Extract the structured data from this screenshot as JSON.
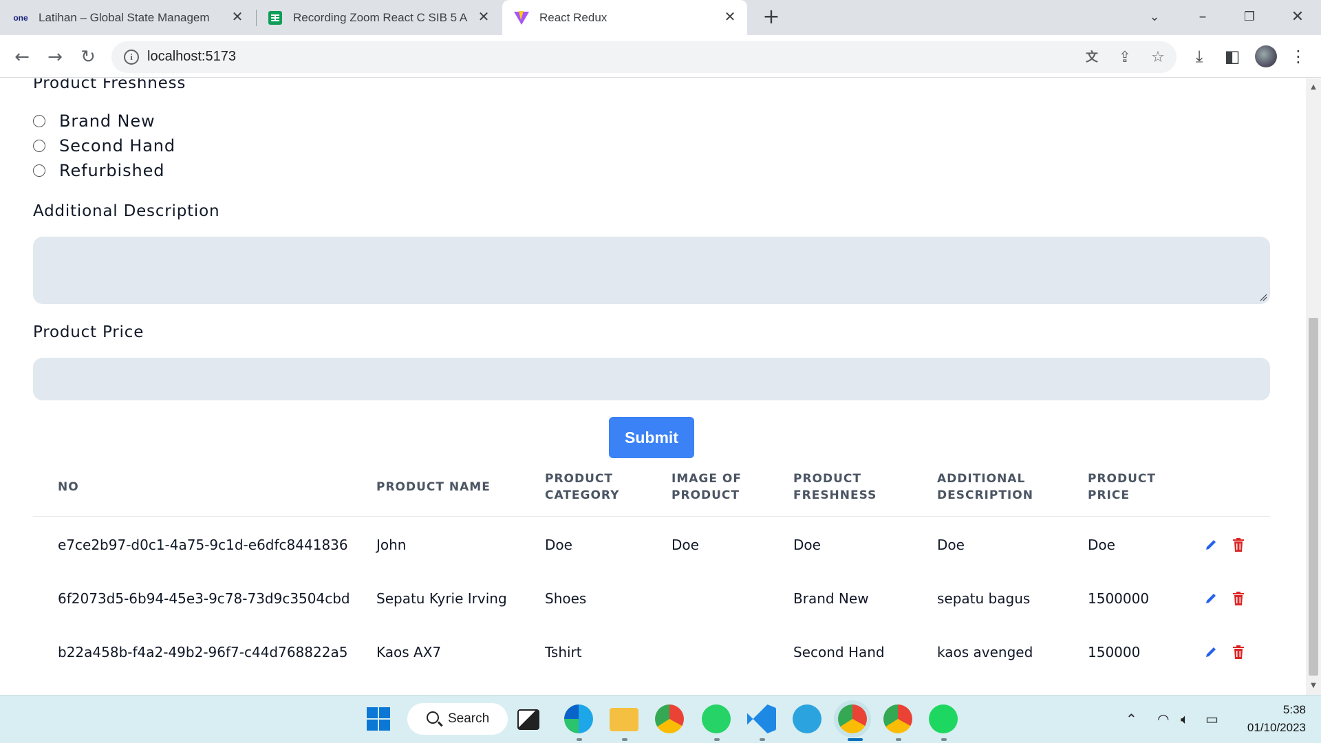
{
  "browser": {
    "tabs": [
      {
        "title": "Latihan – Global State Managem",
        "favicon": "one-logo",
        "active": false
      },
      {
        "title": "Recording Zoom React C SIB 5 A",
        "favicon": "sheets-icon",
        "active": false
      },
      {
        "title": "React Redux",
        "favicon": "vite-icon",
        "active": true
      }
    ],
    "url": "localhost:5173"
  },
  "form": {
    "freshness_label": "Product Freshness",
    "freshness_options": [
      "Brand New",
      "Second Hand",
      "Refurbished"
    ],
    "description_label": "Additional Description",
    "description_value": "",
    "price_label": "Product Price",
    "price_value": "",
    "submit_label": "Submit"
  },
  "table": {
    "headers": [
      [
        "NO"
      ],
      [
        "PRODUCT NAME"
      ],
      [
        "PRODUCT",
        "CATEGORY"
      ],
      [
        "IMAGE OF",
        "PRODUCT"
      ],
      [
        "PRODUCT",
        "FRESHNESS"
      ],
      [
        "ADDITIONAL",
        "DESCRIPTION"
      ],
      [
        "PRODUCT",
        "PRICE"
      ]
    ],
    "rows": [
      [
        "e7ce2b97-d0c1-4a75-9c1d-e6dfc8441836",
        "John",
        "Doe",
        "Doe",
        "Doe",
        "Doe",
        "Doe"
      ],
      [
        "6f2073d5-6b94-45e3-9c78-73d9c3504cbd",
        "Sepatu Kyrie Irving",
        "Shoes",
        "",
        "Brand New",
        "sepatu bagus",
        "1500000"
      ],
      [
        "b22a458b-f4a2-49b2-96f7-c44d768822a5",
        "Kaos AX7",
        "Tshirt",
        "",
        "Second Hand",
        "kaos avenged",
        "150000"
      ]
    ]
  },
  "taskbar": {
    "search_label": "Search",
    "time": "5:38",
    "date": "01/10/2023"
  },
  "colors": {
    "accent": "#3b82f6",
    "field_bg": "#e2e8f0",
    "edit": "#2563eb",
    "delete": "#dc2626"
  }
}
